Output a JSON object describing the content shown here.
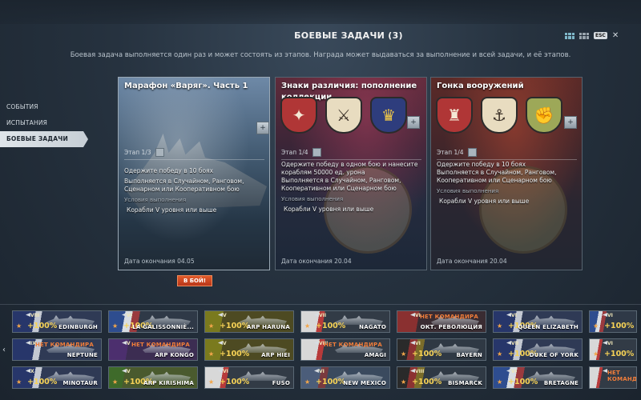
{
  "header": {
    "title": "БОЕВЫЕ ЗАДАЧИ (3)",
    "esc_label": "ESC",
    "subtitle": "Боевая задача выполняется один раз и может состоять из этапов. Награда может выдаваться за выполнение и всей задачи, и её этапов."
  },
  "sidebar": {
    "items": [
      {
        "label": "СОБЫТИЯ"
      },
      {
        "label": "ИСПЫТАНИЯ"
      },
      {
        "label": "БОЕВЫЕ ЗАДАЧИ"
      }
    ]
  },
  "cards": [
    {
      "title": "Марафон «Варяг». Часть 1",
      "stage": "Этап 1/3",
      "task": "Одержите победу в 10 боях",
      "modes": "Выполняется в Случайном, Ранговом, Сценарном или Кооперативном бою",
      "conditions_label": "Условия выполнения",
      "conditions": "Корабли V уровня или выше",
      "end_date": "Дата окончания 04.05"
    },
    {
      "title": "Знаки различия: пополнение коллекции",
      "stage": "Этап 1/4",
      "task": "Одержите победу в одном бою и нанесите кораблям 50000 ед. урона",
      "modes": "Выполняется в Случайном, Ранговом, Кооперативном или Сценарном бою",
      "conditions_label": "Условия выполнения",
      "conditions": "Корабли V уровня или выше",
      "end_date": "Дата окончания 20.04"
    },
    {
      "title": "Гонка вооружений",
      "stage": "Этап 1/4",
      "task": "Одержите победу в 10 боях",
      "modes": "Выполняется в Случайном, Ранговом, Кооперативном или Сценарном бою",
      "conditions_label": "Условия выполнения",
      "conditions": "Корабли V уровня или выше",
      "end_date": "Дата окончания 20.04"
    }
  ],
  "go_button": "В БОЙ!",
  "ships": [
    {
      "name": "EDINBURGH",
      "tier": "VIII",
      "bonus": "+100%",
      "no_commander": ""
    },
    {
      "name": "LA GALISSONNIÈ...",
      "tier": "VI",
      "bonus": "+100%",
      "no_commander": ""
    },
    {
      "name": "ARP HARUNA",
      "tier": "V",
      "bonus": "+100%",
      "no_commander": ""
    },
    {
      "name": "NAGATO",
      "tier": "VII",
      "bonus": "+100%",
      "no_commander": ""
    },
    {
      "name": "ОКТ. РЕВОЛЮЦИЯ",
      "tier": "VI",
      "bonus": "",
      "no_commander": "НЕТ КОМАНДИРА"
    },
    {
      "name": "QUEEN ELIZABETH",
      "tier": "VI",
      "bonus": "+100%",
      "no_commander": ""
    },
    {
      "name": "DUNKERQUE",
      "tier": "VI",
      "bonus": "+100%",
      "no_commander": ""
    },
    {
      "name": "NEPTUNE",
      "tier": "IX",
      "bonus": "",
      "no_commander": "НЕТ КОМАНДИРА"
    },
    {
      "name": "ARP KONGO",
      "tier": "V",
      "bonus": "",
      "no_commander": "НЕТ КОМАНДИРА"
    },
    {
      "name": "ARP HIEI",
      "tier": "V",
      "bonus": "+100%",
      "no_commander": ""
    },
    {
      "name": "AMAGI",
      "tier": "VIII",
      "bonus": "",
      "no_commander": "НЕТ КОМАНДИРА"
    },
    {
      "name": "BAYERN",
      "tier": "VI",
      "bonus": "+100%",
      "no_commander": ""
    },
    {
      "name": "DUKE OF YORK",
      "tier": "VII",
      "bonus": "+100%",
      "no_commander": ""
    },
    {
      "name": "",
      "tier": "VI",
      "bonus": "+100%",
      "no_commander": ""
    },
    {
      "name": "MINOTAUR",
      "tier": "X",
      "bonus": "+100%",
      "no_commander": ""
    },
    {
      "name": "ARP KIRISHIMA",
      "tier": "V",
      "bonus": "+100%",
      "no_commander": ""
    },
    {
      "name": "FUSO",
      "tier": "VI",
      "bonus": "+100%",
      "no_commander": ""
    },
    {
      "name": "NEW MEXICO",
      "tier": "VI",
      "bonus": "+100%",
      "no_commander": ""
    },
    {
      "name": "BISMARCK",
      "tier": "VIII",
      "bonus": "+100%",
      "no_commander": ""
    },
    {
      "name": "BRETAGNE",
      "tier": "VI",
      "bonus": "+100%",
      "no_commander": ""
    },
    {
      "name": "",
      "tier": "",
      "bonus": "",
      "no_commander": "НЕТ КОМАНДИРА"
    }
  ]
}
